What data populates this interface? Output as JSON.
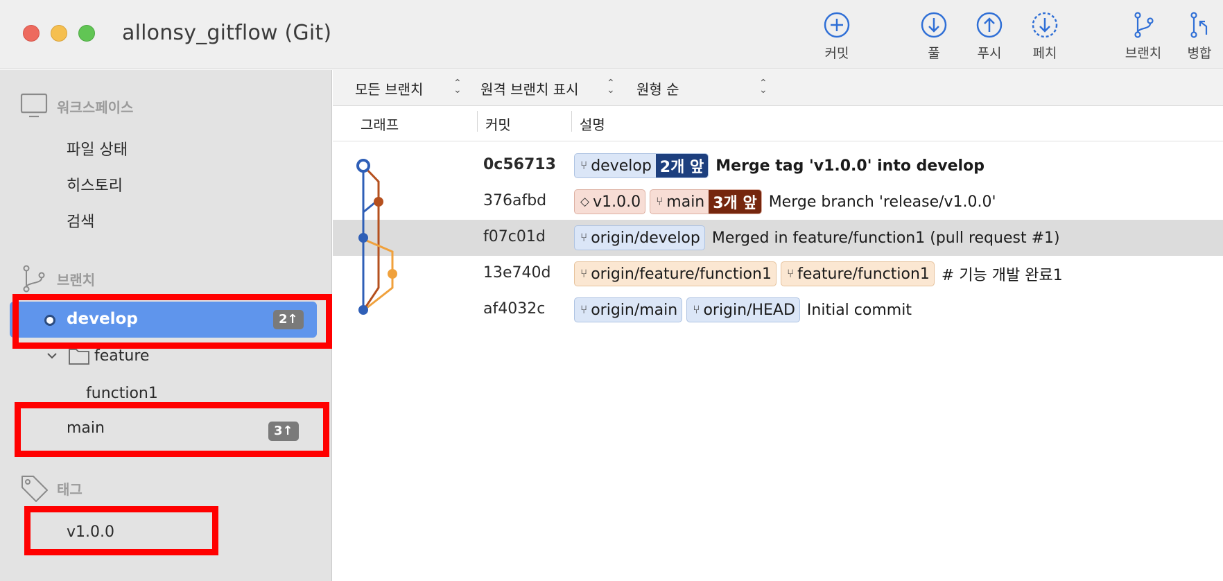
{
  "window": {
    "title": "allonsy_gitflow (Git)"
  },
  "toolbar": {
    "commit": "커밋",
    "pull": "풀",
    "push": "푸시",
    "fetch": "페치",
    "branch": "브랜치",
    "merge": "병합"
  },
  "sidebar": {
    "workspace": {
      "header": "워크스페이스",
      "items": [
        "파일 상태",
        "히스토리",
        "검색"
      ]
    },
    "branches": {
      "header": "브랜치",
      "develop": {
        "name": "develop",
        "ahead": "2↑"
      },
      "feature_folder": "feature",
      "function1": "function1",
      "main": {
        "name": "main",
        "ahead": "3↑"
      }
    },
    "tags": {
      "header": "태그",
      "items": [
        "v1.0.0"
      ]
    }
  },
  "filters": {
    "branch_filter": "모든 브랜치",
    "remote_filter": "원격 브랜치 표시",
    "order_filter": "원형 순"
  },
  "columns": {
    "graph": "그래프",
    "commit": "커밋",
    "description": "설명"
  },
  "commits": [
    {
      "hash": "0c56713",
      "refs": [
        {
          "type": "branch",
          "label": "develop",
          "ahead": "2개 앞"
        }
      ],
      "message": "Merge tag 'v1.0.0' into develop"
    },
    {
      "hash": "376afbd",
      "refs": [
        {
          "type": "tag",
          "label": "v1.0.0"
        },
        {
          "type": "branch",
          "label": "main",
          "ahead": "3개 앞"
        }
      ],
      "message": "Merge branch 'release/v1.0.0'"
    },
    {
      "hash": "f07c01d",
      "refs": [
        {
          "type": "branch",
          "label": "origin/develop"
        }
      ],
      "message": "Merged in feature/function1 (pull request #1)"
    },
    {
      "hash": "13e740d",
      "refs": [
        {
          "type": "branch",
          "label": "origin/feature/function1"
        },
        {
          "type": "branch",
          "label": "feature/function1"
        }
      ],
      "message": "# 기능 개발 완료1"
    },
    {
      "hash": "af4032c",
      "refs": [
        {
          "type": "branch",
          "label": "origin/main"
        },
        {
          "type": "branch",
          "label": "origin/HEAD"
        }
      ],
      "message": "Initial commit"
    }
  ],
  "colors": {
    "selection": "#5f95ec",
    "graph_blue": "#2f5fb7",
    "graph_brown": "#b5501e",
    "graph_orange": "#f0a13c",
    "highlight": "#ff0000"
  }
}
